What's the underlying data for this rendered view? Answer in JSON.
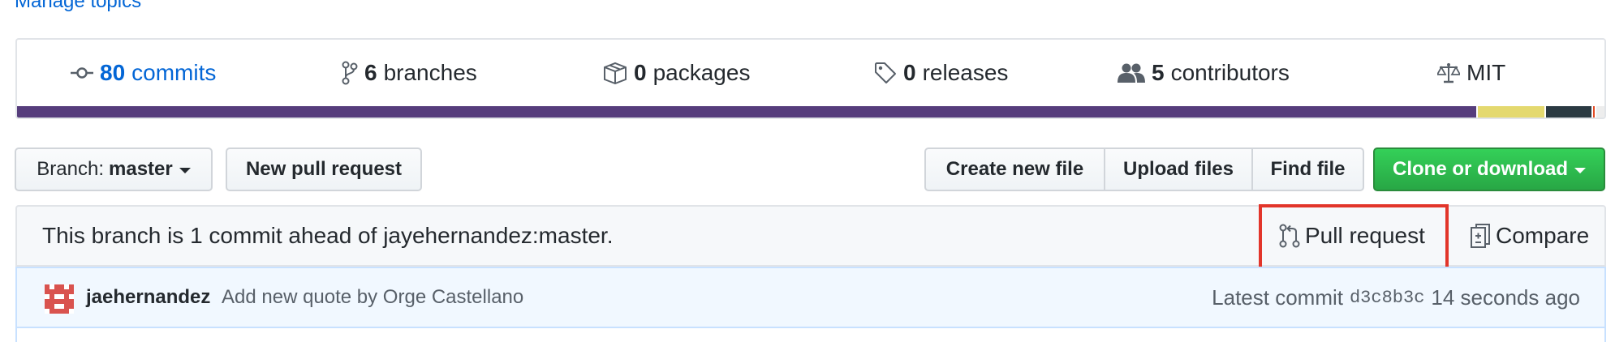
{
  "repo_meta": {
    "manage_topics_label": "Manage topics"
  },
  "summary": {
    "commits": {
      "count": "80",
      "label": "commits",
      "icon": "commit-icon"
    },
    "branches": {
      "count": "6",
      "label": "branches",
      "icon": "git-branch-icon"
    },
    "packages": {
      "count": "0",
      "label": "packages",
      "icon": "package-icon"
    },
    "releases": {
      "count": "0",
      "label": "releases",
      "icon": "tag-icon"
    },
    "contributors": {
      "count": "5",
      "label": "contributors",
      "icon": "people-icon"
    },
    "license": {
      "label": "MIT",
      "icon": "law-icon"
    }
  },
  "language_bar": [
    {
      "color": "#563d7c",
      "percent": 91.9
    },
    {
      "color": "#e4d96f",
      "percent": 4.3
    },
    {
      "color": "#2b3a42",
      "percent": 3.0
    },
    {
      "color": "#e34c26",
      "percent": 0.2
    },
    {
      "color": "#ededed",
      "percent": 0.6
    }
  ],
  "toolbar": {
    "branch_prefix": "Branch:",
    "branch_name": "master",
    "new_pull_request": "New pull request",
    "create_new_file": "Create new file",
    "upload_files": "Upload files",
    "find_file": "Find file",
    "clone_or_download": "Clone or download"
  },
  "branch_info": {
    "message": "This branch is 1 commit ahead of jayehernandez:master.",
    "pull_request_label": "Pull request",
    "compare_label": "Compare"
  },
  "latest_commit": {
    "author": "jaehernandez",
    "message": "Add new quote by Orge Castellano",
    "prefix": "Latest commit",
    "sha": "d3c8b3c",
    "time": "14 seconds ago"
  },
  "colors": {
    "link": "#0366d6",
    "primary_button": "#28a745",
    "highlight": "#e2352a",
    "commit_tease_bg": "#f1f8ff"
  }
}
